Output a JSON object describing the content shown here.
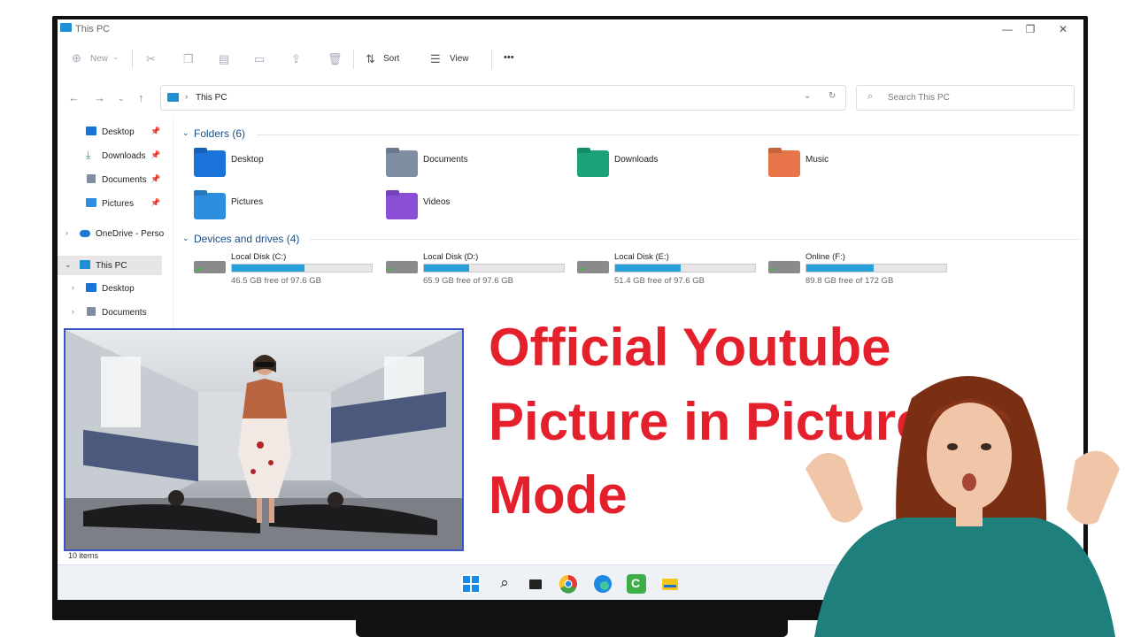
{
  "window": {
    "title": "This PC"
  },
  "toolbar": {
    "new_label": "New",
    "sort_label": "Sort",
    "view_label": "View",
    "more_label": "•••"
  },
  "address": {
    "path": "This PC",
    "search_placeholder": "Search This PC"
  },
  "sidebar": {
    "items": [
      {
        "label": "Desktop",
        "icon": "desktop-icon",
        "pinned": true
      },
      {
        "label": "Downloads",
        "icon": "download-icon",
        "pinned": true
      },
      {
        "label": "Documents",
        "icon": "document-icon",
        "pinned": true
      },
      {
        "label": "Pictures",
        "icon": "picture-icon",
        "pinned": true
      },
      {
        "label": "OneDrive - Perso",
        "icon": "onedrive-icon"
      },
      {
        "label": "This PC",
        "icon": "this-pc-icon",
        "selected": true
      },
      {
        "label": "Desktop",
        "icon": "desktop-icon"
      },
      {
        "label": "Documents",
        "icon": "document-icon"
      }
    ]
  },
  "folders": {
    "header": "Folders (6)",
    "items": [
      {
        "label": "Desktop",
        "color": "#1a73d9"
      },
      {
        "label": "Documents",
        "color": "#7f8ea3"
      },
      {
        "label": "Downloads",
        "color": "#1aa37a"
      },
      {
        "label": "Music",
        "color": "#e8754a"
      },
      {
        "label": "Pictures",
        "color": "#2d8ee0"
      },
      {
        "label": "Videos",
        "color": "#8a4fd6"
      }
    ]
  },
  "drives": {
    "header": "Devices and drives (4)",
    "items": [
      {
        "label": "Local Disk (C:)",
        "free": "46.5 GB free of 97.6 GB",
        "used_fraction": 0.52
      },
      {
        "label": "Local Disk (D:)",
        "free": "65.9 GB free of 97.6 GB",
        "used_fraction": 0.32
      },
      {
        "label": "Local Disk (E:)",
        "free": "51.4 GB free of 97.6 GB",
        "used_fraction": 0.47
      },
      {
        "label": "Online (F:)",
        "free": "89.8 GB free of 172 GB",
        "used_fraction": 0.48
      }
    ]
  },
  "status": {
    "items": "10 items"
  },
  "headline": {
    "line1": "Official Youtube",
    "line2": "Picture in Picture",
    "line3": "Mode"
  },
  "colors": {
    "accent": "#26a0da",
    "headline": "#e3202c",
    "pip_border": "#3b53c8"
  }
}
